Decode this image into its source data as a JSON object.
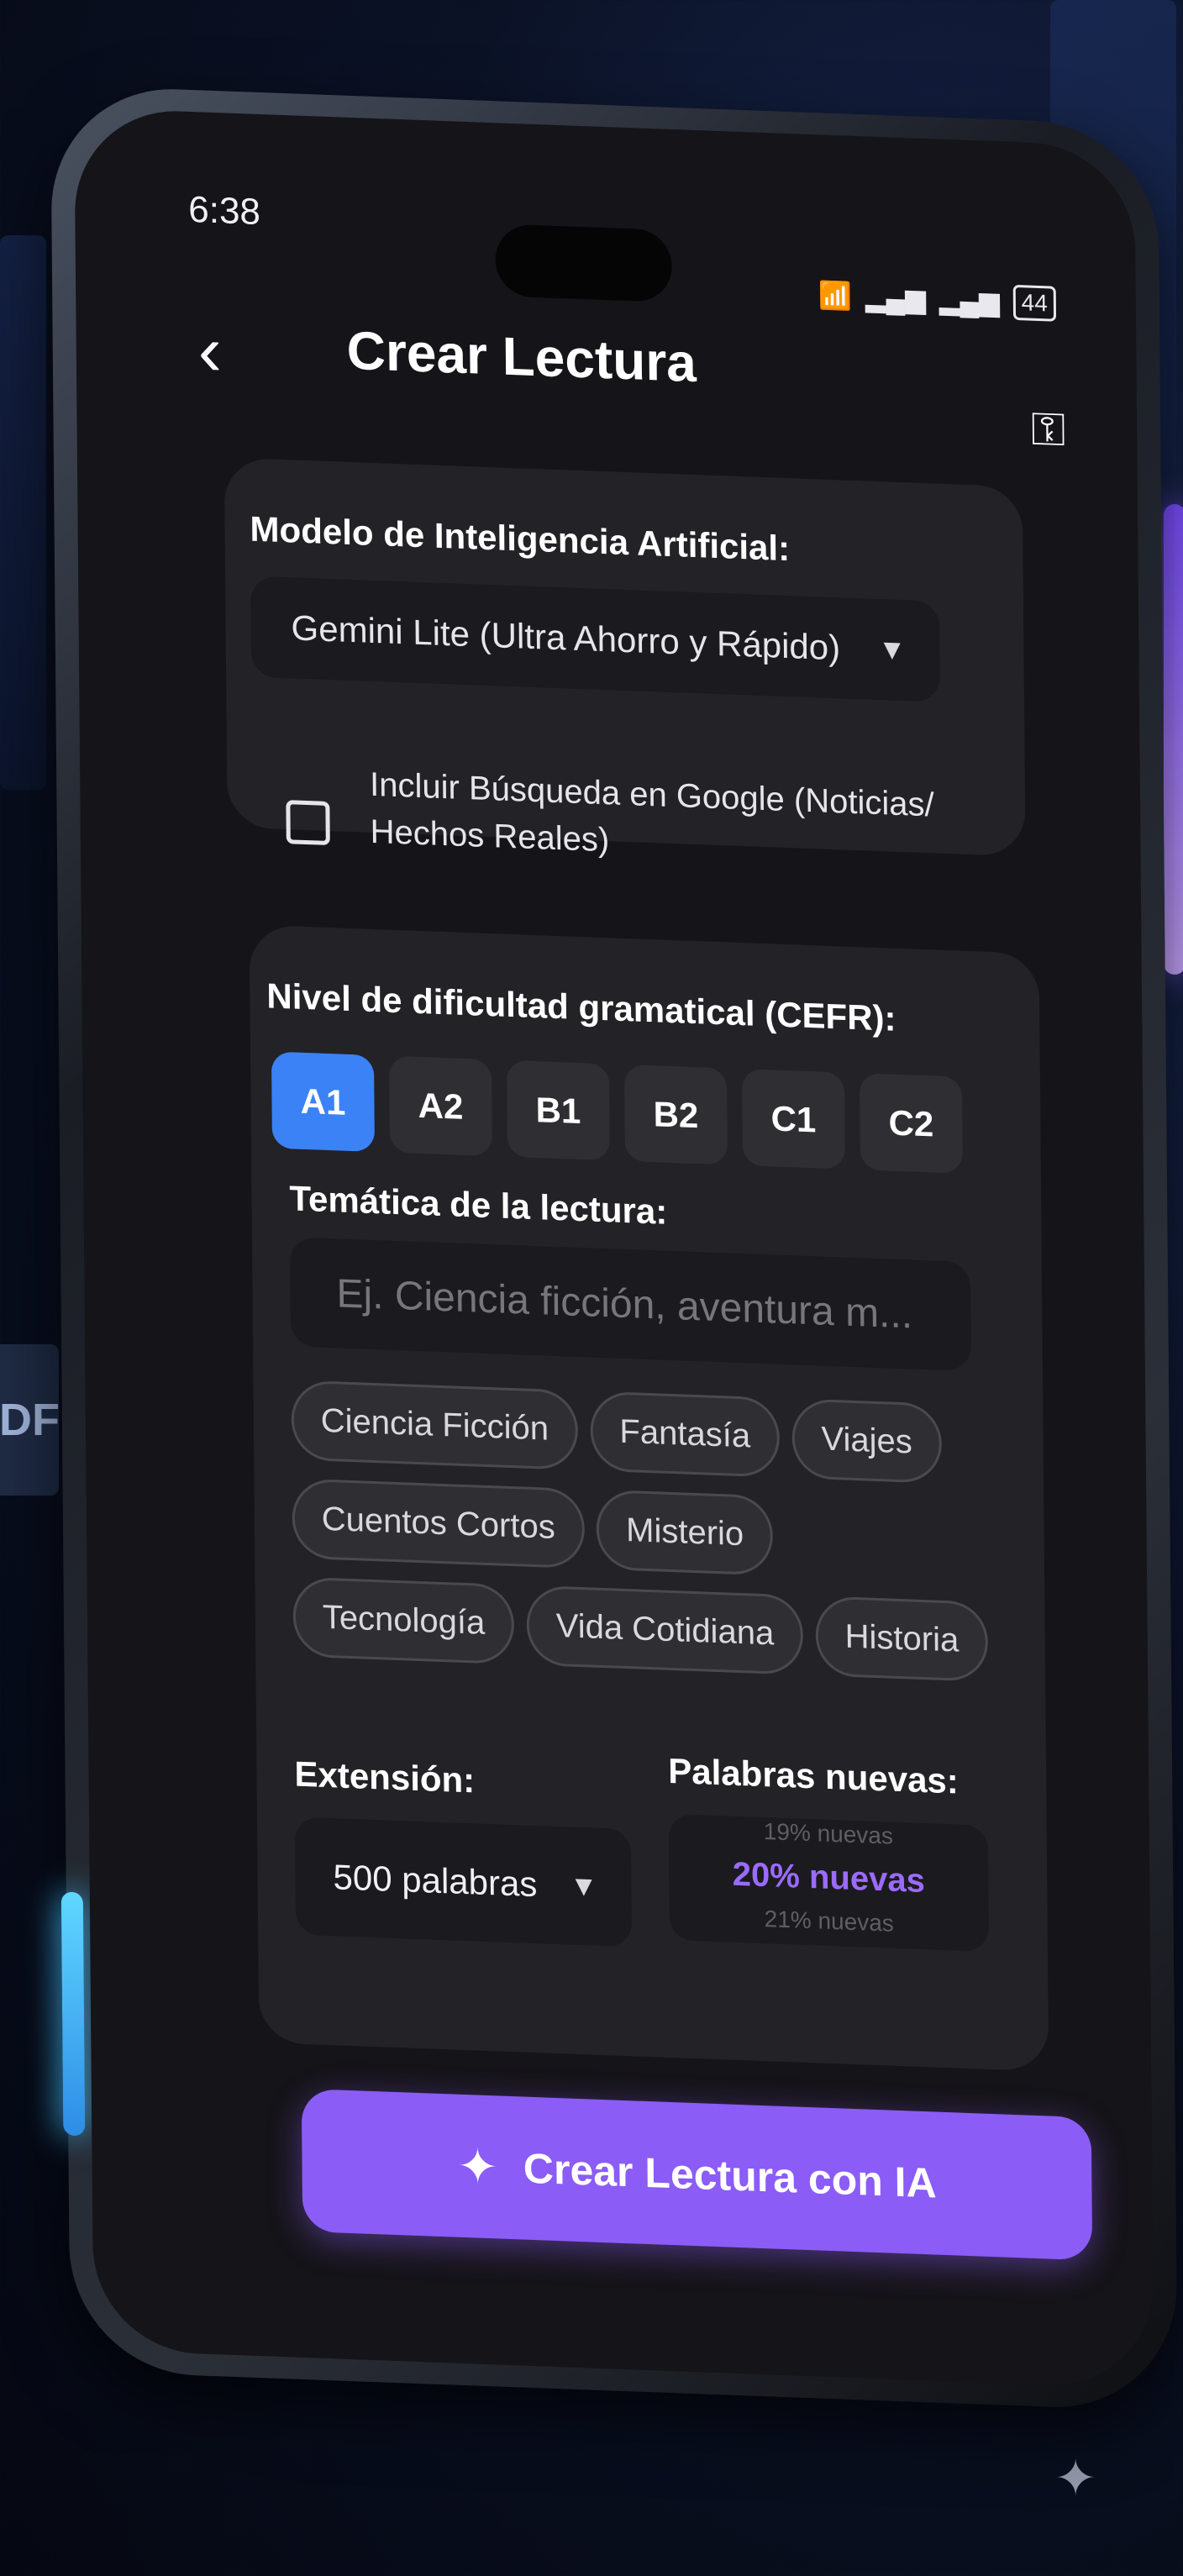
{
  "status": {
    "time": "6:38",
    "battery": "44"
  },
  "header": {
    "title": "Crear Lectura"
  },
  "model_card": {
    "label": "Modelo de Inteligencia Artificial:",
    "selected_model": "Gemini Lite (Ultra Ahorro y Rápido)",
    "search_checkbox_label": "Incluir Búsqueda en Google (Noticias/ Hechos Reales)",
    "search_checked": false
  },
  "config_card": {
    "cefr_label": "Nivel de dificultad gramatical (CEFR):",
    "cefr_levels": [
      "A1",
      "A2",
      "B1",
      "B2",
      "C1",
      "C2"
    ],
    "cefr_selected": "A1",
    "theme_label": "Temática de la lectura:",
    "theme_placeholder": "Ej. Ciencia ficción, aventura m...",
    "theme_tags": [
      "Ciencia Ficción",
      "Fantasía",
      "Viajes",
      "Cuentos Cortos",
      "Misterio",
      "Tecnología",
      "Vida Cotidiana",
      "Historia"
    ],
    "extension_label": "Extensión:",
    "extension_value": "500 palabras",
    "new_words_label": "Palabras nuevas:",
    "new_words_prev": "19% nuevas",
    "new_words_current": "20% nuevas",
    "new_words_next": "21% nuevas"
  },
  "cta": {
    "label": "Crear Lectura con IA"
  },
  "background": {
    "badge_text": "DF"
  },
  "colors": {
    "accent_purple": "#8b5cf6",
    "accent_blue": "#3b82f6",
    "card": "#232226",
    "screen": "#151418"
  }
}
